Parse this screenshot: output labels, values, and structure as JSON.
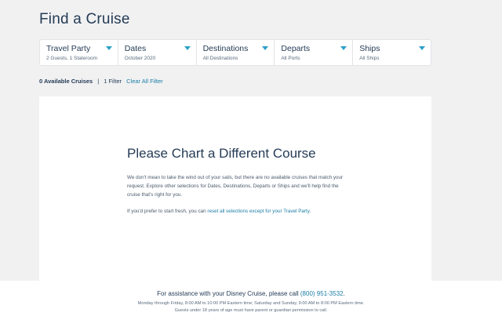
{
  "page": {
    "title": "Find a Cruise"
  },
  "filters": [
    {
      "label": "Travel Party",
      "value": "2 Guests, 1 Stateroom",
      "icon": "chevron-down-icon"
    },
    {
      "label": "Dates",
      "value": "October 2020",
      "icon": "chevron-down-icon"
    },
    {
      "label": "Destinations",
      "value": "All Destinations",
      "icon": "chevron-down-icon"
    },
    {
      "label": "Departs",
      "value": "All Ports",
      "icon": "chevron-down-icon"
    },
    {
      "label": "Ships",
      "value": "All Ships",
      "icon": "chevron-down-icon"
    }
  ],
  "summary": {
    "count": "0 Available Cruises",
    "separator": "|",
    "filters": "1 Filter",
    "clear": "Clear All Filter"
  },
  "card": {
    "title": "Please Chart a Different Course",
    "body1": "We don't mean to take the wind out of your sails, but there are no available cruises that match your request. Explore other selections for Dates, Destinations, Departs or Ships and we'll help find the cruise that's right for you.",
    "body2_prefix": "If you'd prefer to start fresh, you can ",
    "body2_link": "reset all selections except for your Travel Party",
    "body2_suffix": "."
  },
  "footer": {
    "assist_prefix": "For assistance with your Disney Cruise, please call ",
    "phone": "(800) 951-3532",
    "assist_suffix": ".",
    "hours": "Monday through Friday, 8:00 AM to 10:00 PM Eastern time; Saturday and Sunday, 9:00 AM to 8:00 PM Eastern time.",
    "note": "Guests under 18 years of age must have parent or guardian permission to call."
  },
  "colors": {
    "accent": "#2b9fc8",
    "link": "#1c7da6",
    "text": "#253b56",
    "background": "#f1f1f2"
  }
}
